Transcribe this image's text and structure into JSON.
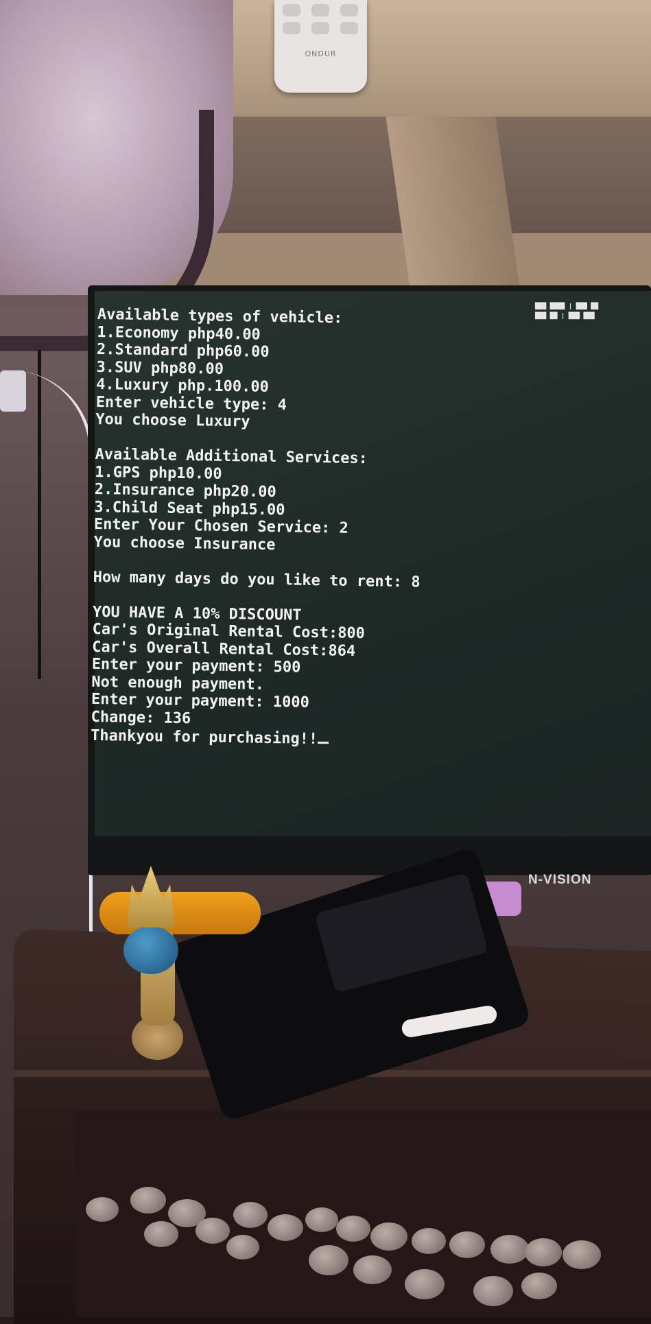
{
  "terminal": {
    "lines": [
      "Available types of vehicle:",
      "1.Economy php40.00",
      "2.Standard php60.00",
      "3.SUV php80.00",
      "4.Luxury php.100.00",
      "Enter vehicle type: 4",
      "You choose Luxury",
      "",
      "Available Additional Services:",
      "1.GPS php10.00",
      "2.Insurance php20.00",
      "3.Child Seat php15.00",
      "Enter Your Chosen Service: 2",
      "You choose Insurance",
      "",
      "How many days do you like to rent: 8",
      "",
      "YOU HAVE A 10% DISCOUNT",
      "Car's Original Rental Cost:800",
      "Car's Overall Rental Cost:864",
      "Enter your payment: 500",
      "Not enough payment.",
      "Enter your payment: 1000",
      "Change: 136",
      "Thankyou for purchasing!!"
    ]
  },
  "monitor": {
    "brand": "N-VISION"
  },
  "remote": {
    "brand": "ONDUR"
  },
  "colors": {
    "screen": "#222c29",
    "terminal_text": "#f2f2f2",
    "bezel": "#141516",
    "desk": "#2b1d1b"
  }
}
